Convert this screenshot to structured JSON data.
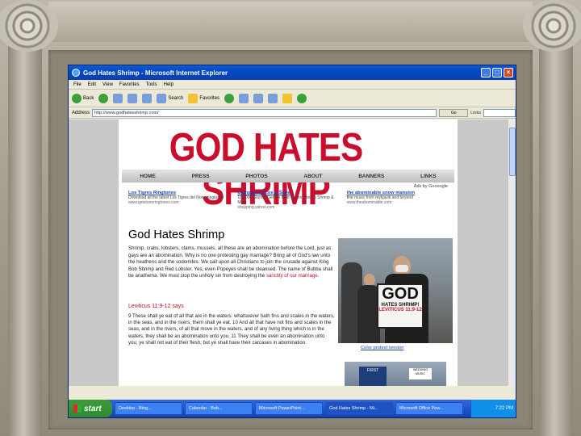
{
  "window": {
    "title": "God Hates Shrimp - Microsoft Internet Explorer",
    "buttons": {
      "min": "_",
      "max": "□",
      "close": "×"
    }
  },
  "menu": [
    "File",
    "Edit",
    "View",
    "Favorites",
    "Tools",
    "Help"
  ],
  "toolbar": {
    "back": "Back",
    "search": "Search",
    "favorites": "Favorites"
  },
  "address": {
    "label": "Address",
    "url": "http://www.godhatesshrimp.com/",
    "go": "Go",
    "links": "Links"
  },
  "site": {
    "logo": "GOD HATES SHRIMP",
    "nav": [
      "HOME",
      "PRESS",
      "PHOTOS",
      "ABOUT",
      "BANNERS",
      "LINKS"
    ],
    "meta": "Ads by Goooogle",
    "ads": [
      {
        "title": "Los Tigres Ringtones",
        "text": "Download all the latest Los Tigres del Norte ringtones",
        "url": "www.getstoneringtones.com"
      },
      {
        "title": "Compare Prices & Save",
        "text": "100,000 Stores. Get the Best Prices. Hot on Shrimp & More",
        "url": "shopping.yahoo.com"
      },
      {
        "title": "the abominable snow mansion",
        "text": "fine music from reykjavik and beyond",
        "url": "www.theabominable.com"
      }
    ],
    "article_title": "God Hates Shrimp",
    "body": "Shrimp, crabs, lobsters, clams, mussels, all these are an abomination before the Lord, just as gays are an abomination. Why is no one protesting gay marriage? Bring all of God's law unto the heathens and the sodomites. We call upon all Christians to join the crusade against King Bob Shrimp and Red Lobster. Yes, even Popeyes shall be cleansed. The name of Bubba shall be anathema. We must stop the unholy sin from destroying the sanctity of our marriage.",
    "link_text": "sanctity of our marriage",
    "leviticus": "Leviticus 11:9-12 says",
    "verses": "9 These shall ye eat of all that are in the waters: whatsoever hath fins and scales in the waters, in the seas, and in the rivers, them shall ye eat. 10 And all that have not fins and scales in the seas, and in the rivers, of all that move in the waters, and of any living thing which is in the waters, they shall be an abomination unto you. 11 They shall be even an abomination unto you; ye shall not eat of their flesh, but ye shall have their carcases in abomination.",
    "sign": {
      "big": "GOD",
      "small": "HATES SHRIMP!",
      "ref": "LEVITICUS 11:9-12"
    },
    "caption": "Color protest version",
    "photo2": {
      "blue": "FIRST",
      "white": "WEDDING MUSIC"
    }
  },
  "taskbar": {
    "start": "start",
    "tasks": [
      "Desktop - Bing...",
      "Calendar - Bob...",
      "Microsoft PowerPoint...",
      "God Hates Shrimp - Mi...",
      "Microsoft Office Pow..."
    ],
    "clock": "7:22 PM"
  }
}
